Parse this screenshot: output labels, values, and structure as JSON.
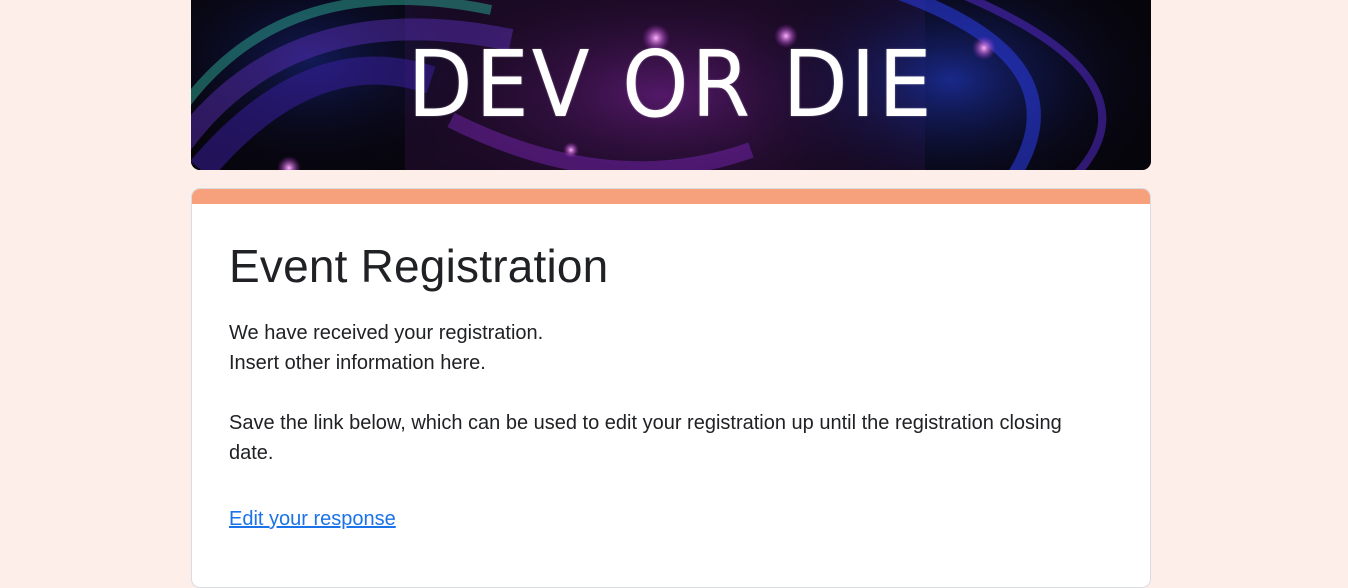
{
  "banner": {
    "title": "DEV OR DIE",
    "icon": "neon-abstract-banner-image"
  },
  "form": {
    "title": "Event Registration",
    "confirmation_lines": [
      "We have received your registration.",
      "Insert other information here.",
      "Save the link below, which can be used to edit your registration up until the registration closing date."
    ],
    "edit_link_label": "Edit your response"
  },
  "colors": {
    "page_background": "#fdeee9",
    "accent": "#f7a07c",
    "link": "#1a73e8",
    "text": "#202124"
  }
}
